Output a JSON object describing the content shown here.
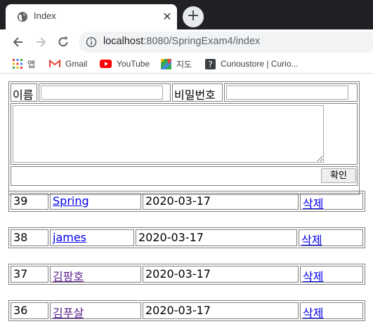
{
  "browser": {
    "tab_title": "Index",
    "url_host": "localhost",
    "url_rest": ":8080/SpringExam4/index",
    "bookmarks": [
      {
        "label": "앱",
        "icon": "apps-grid-icon"
      },
      {
        "label": "Gmail",
        "icon": "gmail-icon"
      },
      {
        "label": "YouTube",
        "icon": "youtube-icon"
      },
      {
        "label": "지도",
        "icon": "maps-icon"
      },
      {
        "label": "Curioustore | Curio...",
        "icon": "curioustore-icon"
      }
    ]
  },
  "form": {
    "name_label": "이름",
    "name_value": "",
    "password_label": "비밀번호",
    "password_value": "",
    "memo_value": "",
    "confirm_label": "확인"
  },
  "rows": [
    {
      "id": "39",
      "name": "Spring",
      "date": "2020-03-17",
      "action": "삭제"
    },
    {
      "id": "38",
      "name": "james",
      "date": "2020-03-17",
      "action": "삭제"
    },
    {
      "id": "37",
      "name": "김팡호",
      "date": "2020-03-17",
      "action": "삭제"
    },
    {
      "id": "36",
      "name": "김푸살",
      "date": "2020-03-17",
      "action": "삭제"
    }
  ],
  "colors": {
    "link": "#0000ee",
    "visited_link": "#551a8b",
    "border": "#808080"
  }
}
